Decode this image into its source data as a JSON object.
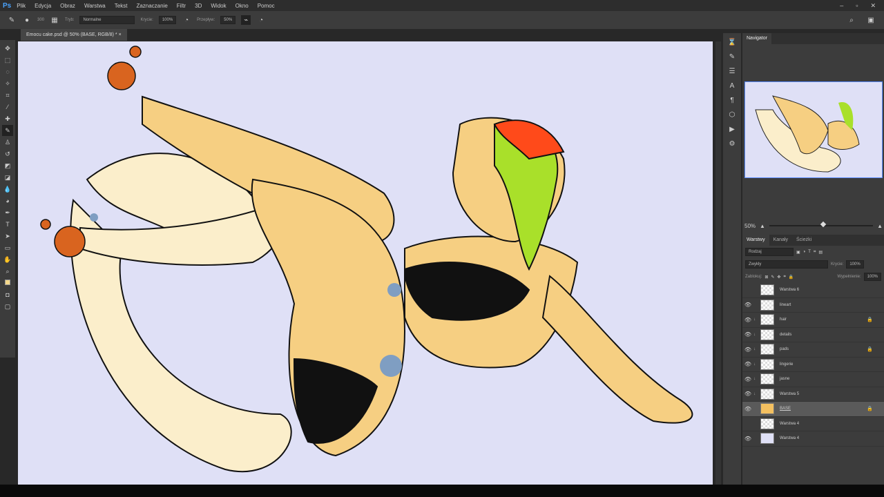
{
  "app": {
    "logo": "Ps"
  },
  "menu": [
    "Plik",
    "Edycja",
    "Obraz",
    "Warstwa",
    "Tekst",
    "Zaznaczanie",
    "Filtr",
    "3D",
    "Widok",
    "Okno",
    "Pomoc"
  ],
  "options": {
    "brush_size": "300",
    "mode_label": "Tryb:",
    "mode_value": "Normalne",
    "opacity_label": "Krycie:",
    "opacity_value": "100%",
    "flow_label": "Przepływ:",
    "flow_value": "50%"
  },
  "document_tab": {
    "title": "Emocu cake.psd @ 50% (BASE, RGB/8) *",
    "close": "×"
  },
  "navigator": {
    "title": "Navigator",
    "zoom": "50%"
  },
  "layers_panel": {
    "tabs": [
      "Warstwy",
      "Kanały",
      "Ścieżki"
    ],
    "filter": "Rodzaj",
    "blend": "Zwykły",
    "opacity_label": "Krycie:",
    "opacity_value": "100%",
    "lock_label": "Zablokuj:",
    "fill_label": "Wypełnienie:",
    "fill_value": "100%",
    "layers": [
      {
        "name": "Warstwa 6",
        "visible": false,
        "clipped": false,
        "locked": false,
        "selected": false
      },
      {
        "name": "lineart",
        "visible": true,
        "clipped": false,
        "locked": false,
        "selected": false
      },
      {
        "name": "hair",
        "visible": true,
        "clipped": true,
        "locked": true,
        "selected": false
      },
      {
        "name": "details",
        "visible": true,
        "clipped": true,
        "locked": false,
        "selected": false
      },
      {
        "name": "pads",
        "visible": true,
        "clipped": true,
        "locked": true,
        "selected": false
      },
      {
        "name": "lingerie",
        "visible": true,
        "clipped": true,
        "locked": false,
        "selected": false
      },
      {
        "name": "jasne",
        "visible": true,
        "clipped": true,
        "locked": false,
        "selected": false
      },
      {
        "name": "Warstwa 5",
        "visible": true,
        "clipped": true,
        "locked": false,
        "selected": false
      },
      {
        "name": "BASE",
        "visible": true,
        "clipped": false,
        "locked": true,
        "selected": true
      },
      {
        "name": "Warstwa 4",
        "visible": false,
        "clipped": false,
        "locked": false,
        "selected": false
      },
      {
        "name": "Warstwa 4",
        "visible": true,
        "clipped": false,
        "locked": false,
        "selected": false
      }
    ]
  }
}
